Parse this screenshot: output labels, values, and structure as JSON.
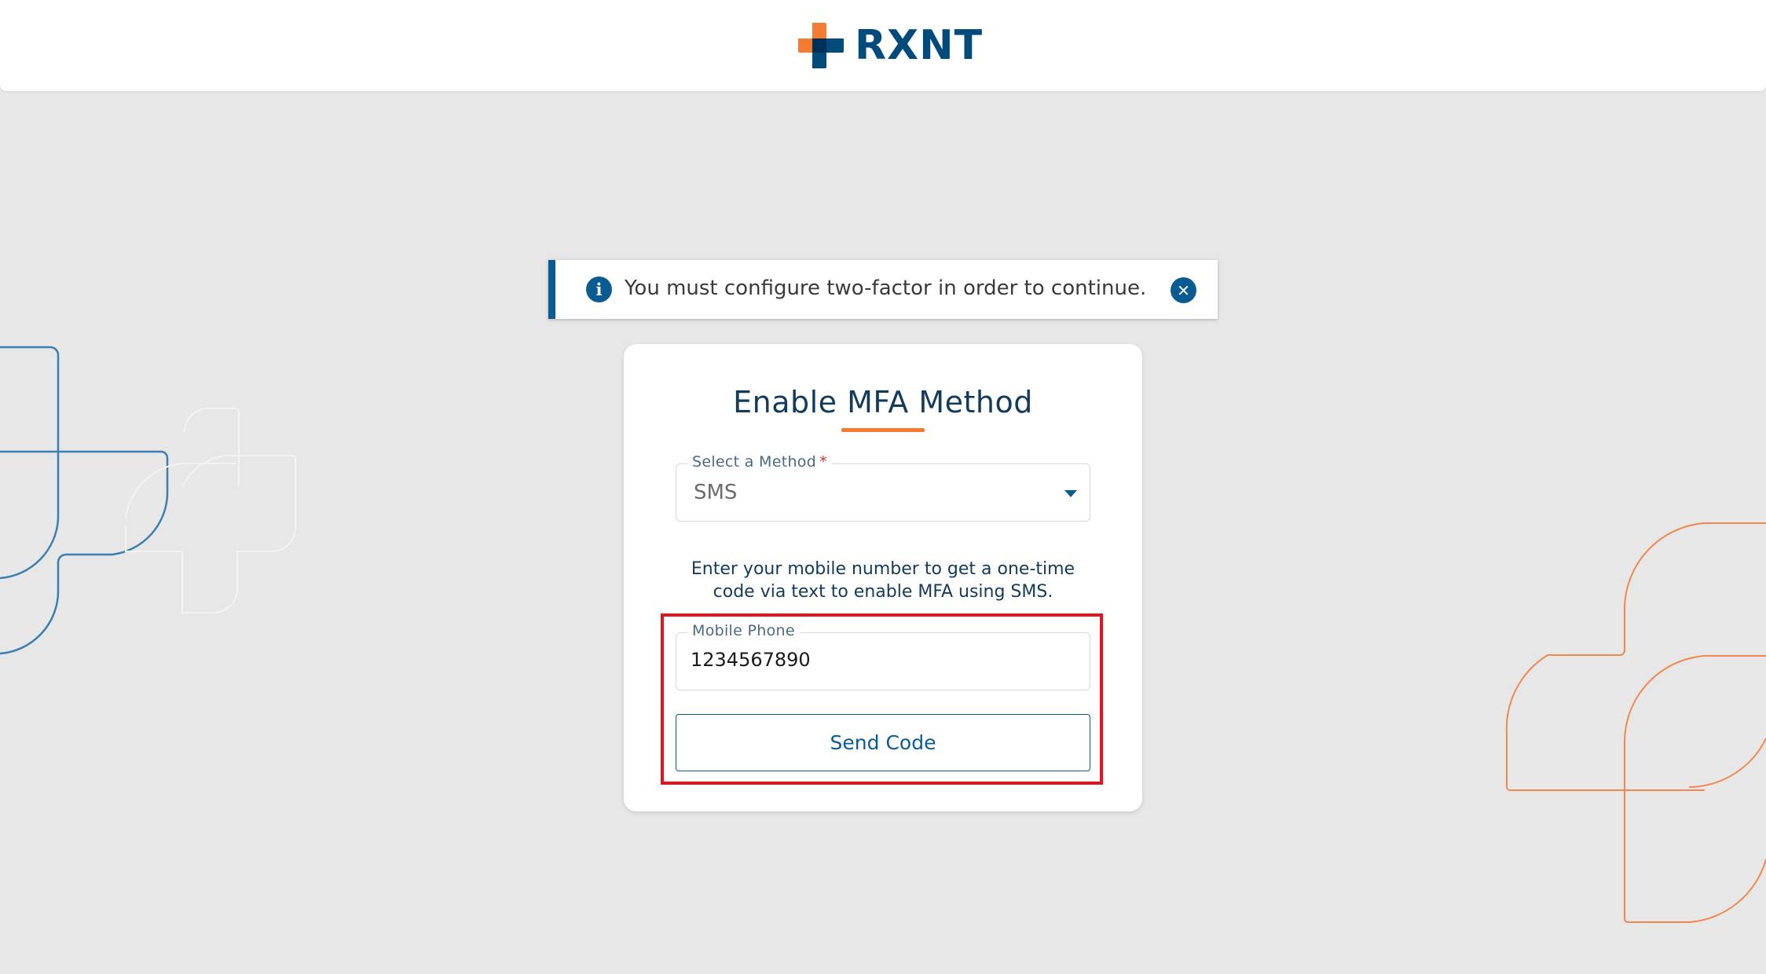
{
  "header": {
    "logo_text": "RXNT",
    "logo_icon": "rxnt-cross-logo"
  },
  "alert": {
    "icon": "info-icon",
    "message": "You must configure two-factor in order to continue.",
    "close_icon": "close-icon"
  },
  "card": {
    "title": "Enable MFA Method",
    "method_field": {
      "label": "Select a Method",
      "required_marker": "*",
      "selected_value": "SMS"
    },
    "help_text_line1": "Enter your mobile number to get a one-time",
    "help_text_line2": "code via text to enable MFA using SMS.",
    "phone_field": {
      "label": "Mobile Phone",
      "value": "1234567890"
    },
    "send_button_label": "Send Code"
  },
  "colors": {
    "brand_blue": "#0a5b92",
    "brand_orange": "#f37b32",
    "highlight_red": "#e3141e"
  }
}
